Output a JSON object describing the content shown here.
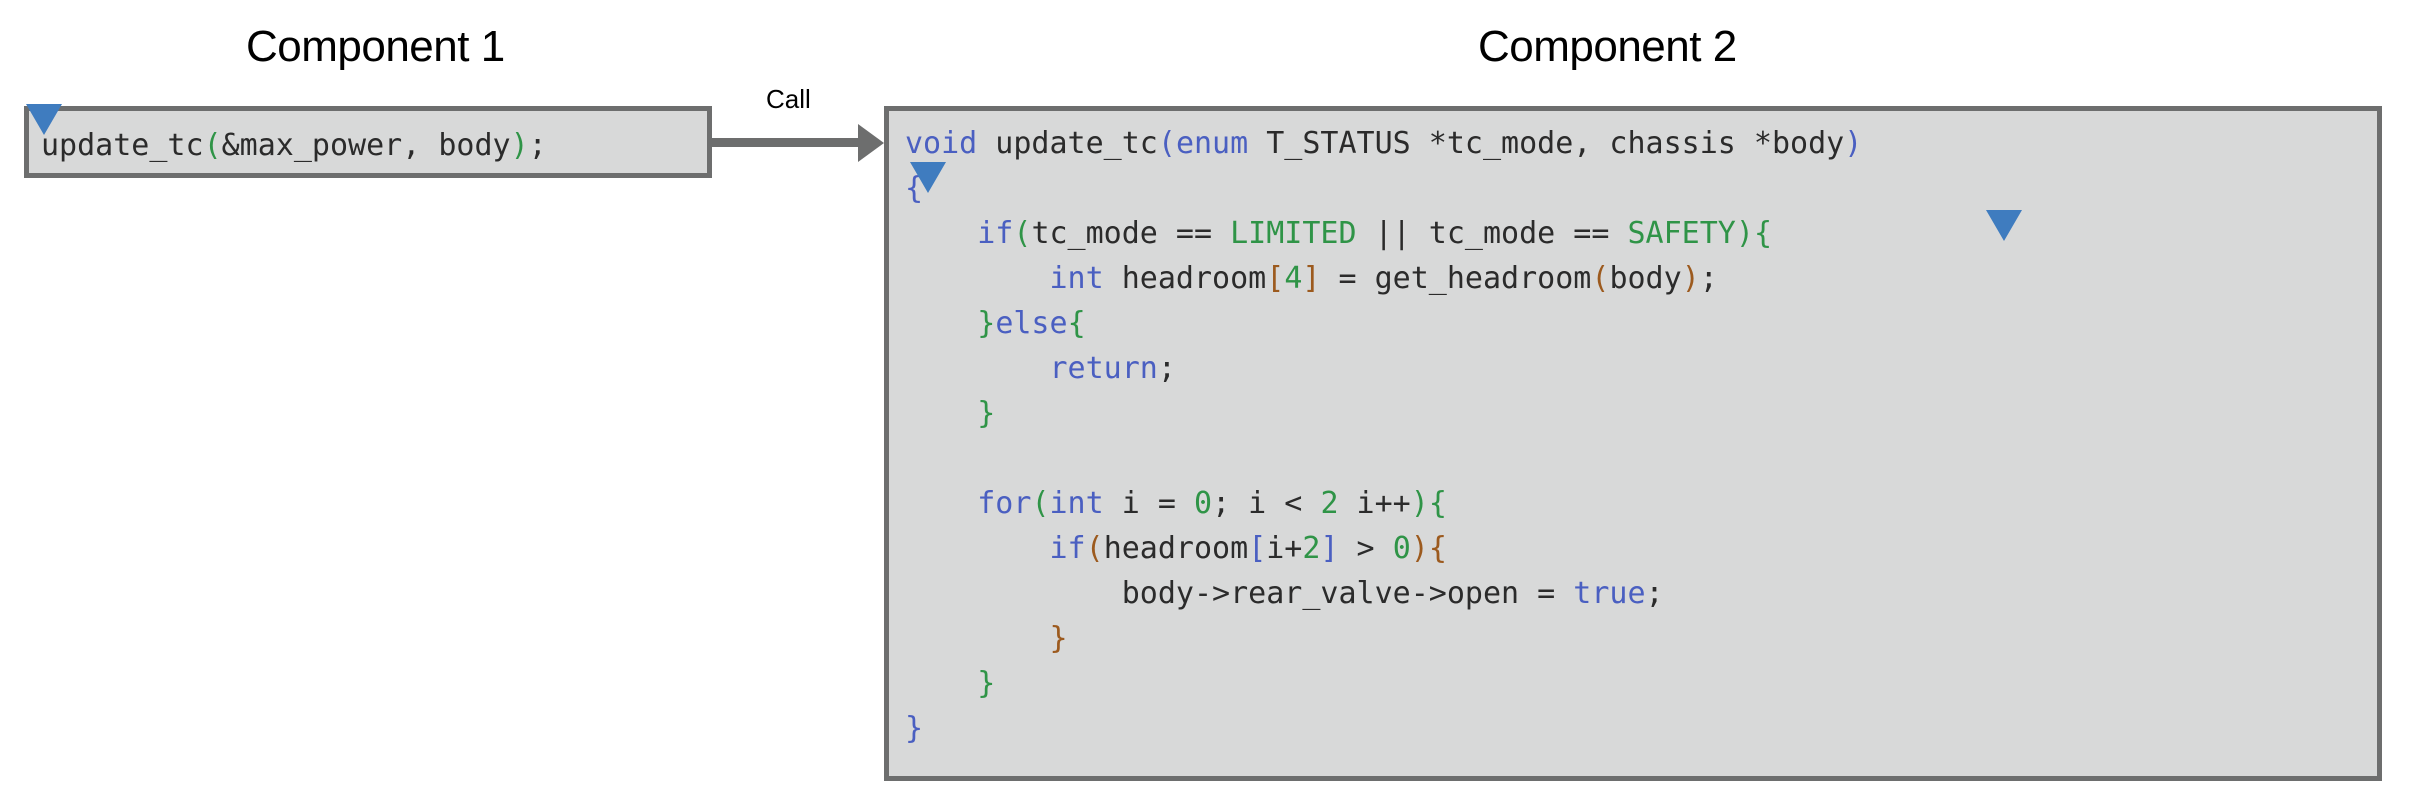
{
  "diagram": {
    "background_color": "#ffffff",
    "panel_bg": "#d8d9d9",
    "panel_border": "#6d6e6e",
    "marker_color": "#3f7cbf",
    "arrow_color": "#6d6e6e"
  },
  "component1": {
    "title": "Component 1",
    "code_line": "update_tc(&max_power, body);",
    "tokens": {
      "call_name": "update_tc",
      "open_paren": "(",
      "args": "&max_power, body",
      "close_paren": ")",
      "semicolon": ";"
    },
    "marker": "collapse-triangle-icon"
  },
  "arrow": {
    "label": "Call",
    "direction": "left-to-right"
  },
  "component2": {
    "title": "Component 2",
    "code_lines": [
      "void update_tc(enum T_STATUS *tc_mode, chassis *body)",
      "{",
      "    if(tc_mode == LIMITED || tc_mode == SAFETY){",
      "        int headroom[4] = get_headroom(body);",
      "    }else{",
      "        return;",
      "    }",
      "",
      "    for(int i = 0; i < 2 i++){",
      "        if(headroom[i+2] > 0){",
      "            body->rear_valve->open = true;",
      "        }",
      "    }",
      "}"
    ],
    "line_parts": {
      "l1": {
        "kw_void": "void",
        "fn_name": " update_tc",
        "paren_open": "(",
        "kw_enum": "enum",
        "params": " T_STATUS *tc_mode, chassis *body",
        "paren_close": ")"
      },
      "l2": {
        "brace_open": "{"
      },
      "l3": {
        "indent": "    ",
        "kw_if": "if",
        "paren_open": "(",
        "cond_a": "tc_mode == ",
        "const_limited": "LIMITED",
        "cond_mid": " || tc_mode == ",
        "const_safety": "SAFETY",
        "paren_close": ")",
        "brace_open": "{"
      },
      "l4": {
        "indent": "        ",
        "kw_int": "int",
        "var": " headroom",
        "bracket_open": "[",
        "index": "4",
        "bracket_close": "]",
        "assign": " = get_headroom",
        "paren_open": "(",
        "arg": "body",
        "paren_close": ")",
        "semicolon": ";"
      },
      "l5": {
        "indent": "    ",
        "brace_close": "}",
        "kw_else": "else",
        "brace_open": "{"
      },
      "l6": {
        "indent": "        ",
        "kw_return": "return",
        "semicolon": ";"
      },
      "l7": {
        "indent": "    ",
        "brace_close": "}"
      },
      "l8": {
        "blank": ""
      },
      "l9": {
        "indent": "    ",
        "kw_for": "for",
        "paren_open": "(",
        "kw_int": "int",
        "init": " i = ",
        "num_zero": "0",
        "sep": "; i < ",
        "num_two": "2",
        "incr": " i++",
        "paren_close": ")",
        "brace_open": "{"
      },
      "l10": {
        "indent": "        ",
        "kw_if": "if",
        "paren_open": "(",
        "var": "headroom",
        "bracket_open": "[",
        "idx_a": "i+",
        "idx_num": "2",
        "bracket_close": "]",
        "cmp": " > ",
        "num_zero": "0",
        "paren_close": ")",
        "brace_open": "{"
      },
      "l11": {
        "indent": "            ",
        "expr": "body->rear_valve->open = ",
        "kw_true": "true",
        "semicolon": ";"
      },
      "l12": {
        "indent": "        ",
        "brace_close": "}"
      },
      "l13": {
        "indent": "    ",
        "brace_close": "}"
      },
      "l14": {
        "brace_close": "}"
      }
    },
    "markers": [
      "collapse-triangle-icon",
      "collapse-triangle-icon"
    ]
  },
  "colors": {
    "keyword": "#4a5fc1",
    "constant": "#2f9447",
    "number": "#2f9447",
    "bracket_depth1": "#2f9447",
    "bracket_depth2": "#9c5a1e",
    "bracket_depth3": "#4a5fc1",
    "plain_text": "#2b2b2b",
    "marker_blue": "#3f7cbf"
  }
}
